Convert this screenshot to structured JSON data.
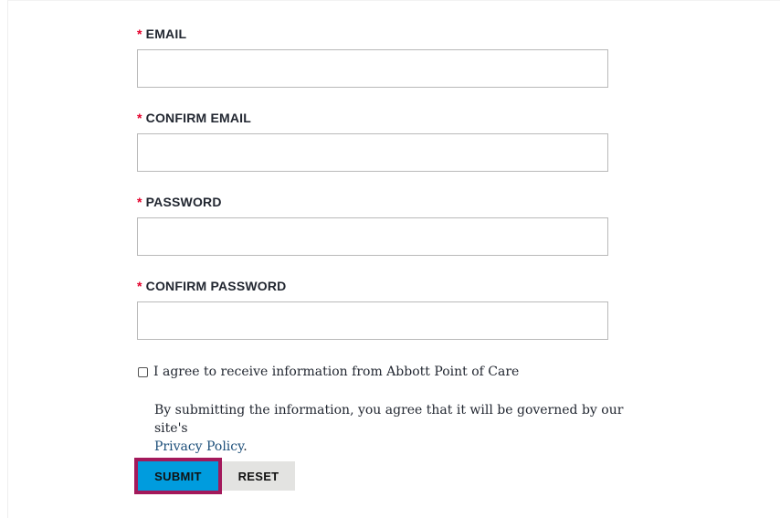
{
  "form": {
    "required_marker": "*",
    "fields": [
      {
        "label": "EMAIL",
        "value": "",
        "placeholder": ""
      },
      {
        "label": "CONFIRM EMAIL",
        "value": "",
        "placeholder": ""
      },
      {
        "label": "PASSWORD",
        "value": "",
        "placeholder": ""
      },
      {
        "label": "CONFIRM PASSWORD",
        "value": "",
        "placeholder": ""
      }
    ],
    "consent_label": "I agree to receive information from Abbott Point of Care",
    "consent_checked": false,
    "disclaimer_text": "By submitting the information, you agree that it will be governed by our site's",
    "privacy_link": "Privacy Policy",
    "disclaimer_end": ".",
    "submit_label": "SUBMIT",
    "reset_label": "RESET"
  },
  "colors": {
    "required": "#e4002b",
    "submit_bg": "#009cde",
    "focus_outline": "#a3195b",
    "reset_bg": "#e3e3e1",
    "link": "#1d4f7a"
  }
}
